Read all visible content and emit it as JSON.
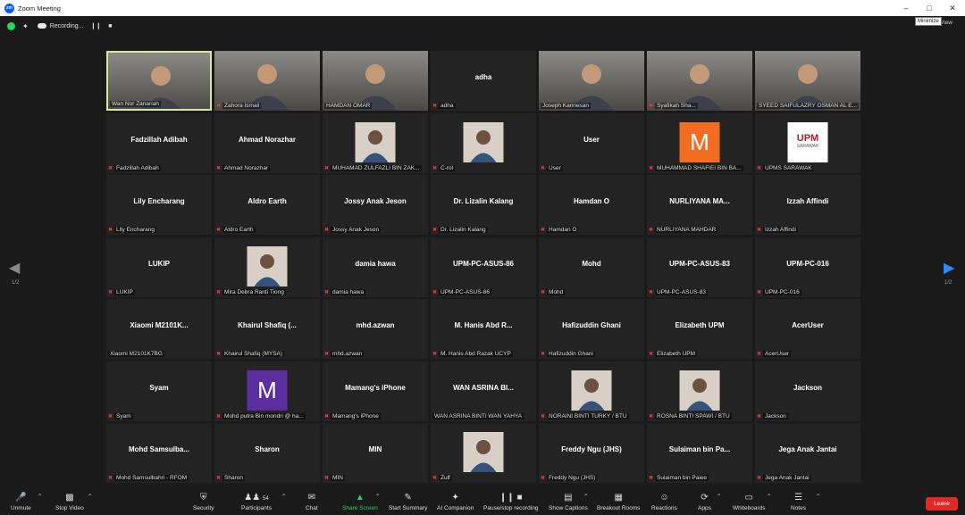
{
  "window": {
    "title": "Zoom Meeting",
    "logo": "zoom",
    "tooltip": "Minimize"
  },
  "topbar": {
    "recording_text": "Recording...",
    "right_text": "Sign In  View",
    "pause_icon": "pause-icon",
    "stop_icon": "stop-icon"
  },
  "pages": {
    "left": "1/2",
    "right": "1/2"
  },
  "participants": [
    {
      "label": "Wan Nor Zanariah",
      "display": "",
      "kind": "video",
      "muted": false,
      "active": true
    },
    {
      "label": "Zahora Ismail",
      "display": "",
      "kind": "video",
      "muted": true,
      "active": false
    },
    {
      "label": "HAMDAN OMAR",
      "display": "",
      "kind": "video",
      "muted": false,
      "active": false
    },
    {
      "label": "adha",
      "display": "adha",
      "kind": "name",
      "muted": true,
      "active": false
    },
    {
      "label": "Joseph Kannesan",
      "display": "",
      "kind": "video",
      "muted": false,
      "active": false
    },
    {
      "label": "Syafikah Sha...",
      "display": "",
      "kind": "video",
      "muted": true,
      "active": false
    },
    {
      "label": "SYEED SAIFULAZRY OSMAN AL E...",
      "display": "",
      "kind": "video",
      "muted": false,
      "active": false
    },
    {
      "label": "Fadzillah Adibah",
      "display": "Fadzillah Adibah",
      "kind": "name",
      "muted": true,
      "active": false
    },
    {
      "label": "Ahmad Norazhar",
      "display": "Ahmad Norazhar",
      "kind": "name",
      "muted": true,
      "active": false
    },
    {
      "label": "MUHAMAD ZULFAZLI BIN ZAK...",
      "display": "",
      "kind": "photo",
      "muted": true,
      "active": false
    },
    {
      "label": "C-rol",
      "display": "",
      "kind": "photo",
      "muted": true,
      "active": false
    },
    {
      "label": "User",
      "display": "User",
      "kind": "name",
      "muted": true,
      "active": false
    },
    {
      "label": "MUHAMMAD SHAFIEI BIN BA...",
      "display": "",
      "kind": "letter",
      "letter": "M",
      "color": "#f26d21",
      "muted": true,
      "active": false
    },
    {
      "label": "UPMS SARAWAK",
      "display": "",
      "kind": "logo",
      "logo_text": "UPM",
      "logo_sub": "SARAWAK",
      "muted": true,
      "active": false
    },
    {
      "label": "Lily Encharang",
      "display": "Lily Encharang",
      "kind": "name",
      "muted": true,
      "active": false
    },
    {
      "label": "Aldro Earth",
      "display": "Aldro Earth",
      "kind": "name",
      "muted": true,
      "active": false
    },
    {
      "label": "Jossy Anak Jeson",
      "display": "Jossy Anak Jeson",
      "kind": "name",
      "muted": true,
      "active": false
    },
    {
      "label": "Dr. Lizalin Kalang",
      "display": "Dr. Lizalin Kalang",
      "kind": "name",
      "muted": true,
      "active": false
    },
    {
      "label": "Hamdan O",
      "display": "Hamdan O",
      "kind": "name",
      "muted": true,
      "active": false
    },
    {
      "label": "NURLIYANA MAHDAR",
      "display": "NURLIYANA MA...",
      "kind": "name",
      "muted": true,
      "active": false
    },
    {
      "label": "Izzah Affindi",
      "display": "Izzah Affindi",
      "kind": "name",
      "muted": true,
      "active": false
    },
    {
      "label": "LUKIP",
      "display": "LUKIP",
      "kind": "name",
      "muted": true,
      "active": false
    },
    {
      "label": "Mira Debra Ranti Tiong",
      "display": "",
      "kind": "photo",
      "muted": true,
      "active": false
    },
    {
      "label": "damia hawa",
      "display": "damia hawa",
      "kind": "name",
      "muted": true,
      "active": false
    },
    {
      "label": "UPM-PC-ASUS-86",
      "display": "UPM-PC-ASUS-86",
      "kind": "name",
      "muted": true,
      "active": false
    },
    {
      "label": "Mohd",
      "display": "Mohd",
      "kind": "name",
      "muted": true,
      "active": false
    },
    {
      "label": "UPM-PC-ASUS-83",
      "display": "UPM-PC-ASUS-83",
      "kind": "name",
      "muted": true,
      "active": false
    },
    {
      "label": "UPM-PC-016",
      "display": "UPM-PC-016",
      "kind": "name",
      "muted": true,
      "active": false
    },
    {
      "label": "Xiaomi M2101K7BG",
      "display": "Xiaomi  M2101K...",
      "kind": "name",
      "muted": false,
      "active": false
    },
    {
      "label": "Khairul Shafiq (MYSA)",
      "display": "Khairul Shafiq (...",
      "kind": "name",
      "muted": true,
      "active": false
    },
    {
      "label": "mhd.azwan",
      "display": "mhd.azwan",
      "kind": "name",
      "muted": true,
      "active": false
    },
    {
      "label": "M. Hanis Abd Razak UCYP",
      "display": "M. Hanis Abd R...",
      "kind": "name",
      "muted": true,
      "active": false
    },
    {
      "label": "Hafizuddin Ghani",
      "display": "Hafizuddin Ghani",
      "kind": "name",
      "muted": true,
      "active": false
    },
    {
      "label": "Elizabeth  UPM",
      "display": "Elizabeth  UPM",
      "kind": "name",
      "muted": true,
      "active": false
    },
    {
      "label": "AcerUser",
      "display": "AcerUser",
      "kind": "name",
      "muted": true,
      "active": false
    },
    {
      "label": "Syam",
      "display": "Syam",
      "kind": "name",
      "muted": true,
      "active": false
    },
    {
      "label": "Mohd putra Bin mondri @ ha...",
      "display": "",
      "kind": "letter",
      "letter": "M",
      "color": "#5b2e9e",
      "muted": true,
      "active": false
    },
    {
      "label": "Mamang's iPhone",
      "display": "Mamang's iPhone",
      "kind": "name",
      "muted": true,
      "active": false
    },
    {
      "label": "WAN ASRINA BINTI WAN YAHYA",
      "display": "WAN ASRINA BI...",
      "kind": "name",
      "muted": false,
      "active": false
    },
    {
      "label": "NORAINI BINTI TURKY / BTU",
      "display": "",
      "kind": "photo",
      "muted": true,
      "active": false
    },
    {
      "label": "ROSNA BINTI SPAWI / BTU",
      "display": "",
      "kind": "photo",
      "muted": true,
      "active": false
    },
    {
      "label": "Jackson",
      "display": "Jackson",
      "kind": "name",
      "muted": true,
      "active": false
    },
    {
      "label": "Mohd Samsulbahri - RFOM",
      "display": "Mohd  Samsulba...",
      "kind": "name",
      "muted": true,
      "active": false
    },
    {
      "label": "Sharon",
      "display": "Sharon",
      "kind": "name",
      "muted": true,
      "active": false
    },
    {
      "label": "MIN",
      "display": "MIN",
      "kind": "name",
      "muted": true,
      "active": false
    },
    {
      "label": "Zulf",
      "display": "",
      "kind": "photo",
      "muted": true,
      "active": false
    },
    {
      "label": "Freddy Ngu (JHS)",
      "display": "Freddy Ngu (JHS)",
      "kind": "name",
      "muted": true,
      "active": false
    },
    {
      "label": "Sulaiman bin Paiee",
      "display": "Sulaiman  bin  Pa...",
      "kind": "name",
      "muted": true,
      "active": false
    },
    {
      "label": "Jega Anak Jantai",
      "display": "Jega Anak Jantai",
      "kind": "name",
      "muted": true,
      "active": false
    }
  ],
  "toolbar": {
    "unmute": "Unmute",
    "stop_video": "Stop Video",
    "security": "Security",
    "participants": "Participants",
    "participant_count": "54",
    "chat": "Chat",
    "share_screen": "Share Screen",
    "start_summary": "Start Summary",
    "ai_companion": "AI Companion",
    "pause_recording": "Pause/stop recording",
    "show_captions": "Show Captions",
    "breakout_rooms": "Breakout Rooms",
    "reactions": "Reactions",
    "apps": "Apps",
    "whiteboards": "Whiteboards",
    "notes": "Notes",
    "leave": "Leave"
  },
  "colors": {
    "accent": "#0b5cff",
    "share_green": "#23d959",
    "leave_red": "#e02828",
    "active_border": "#d6e89a"
  }
}
